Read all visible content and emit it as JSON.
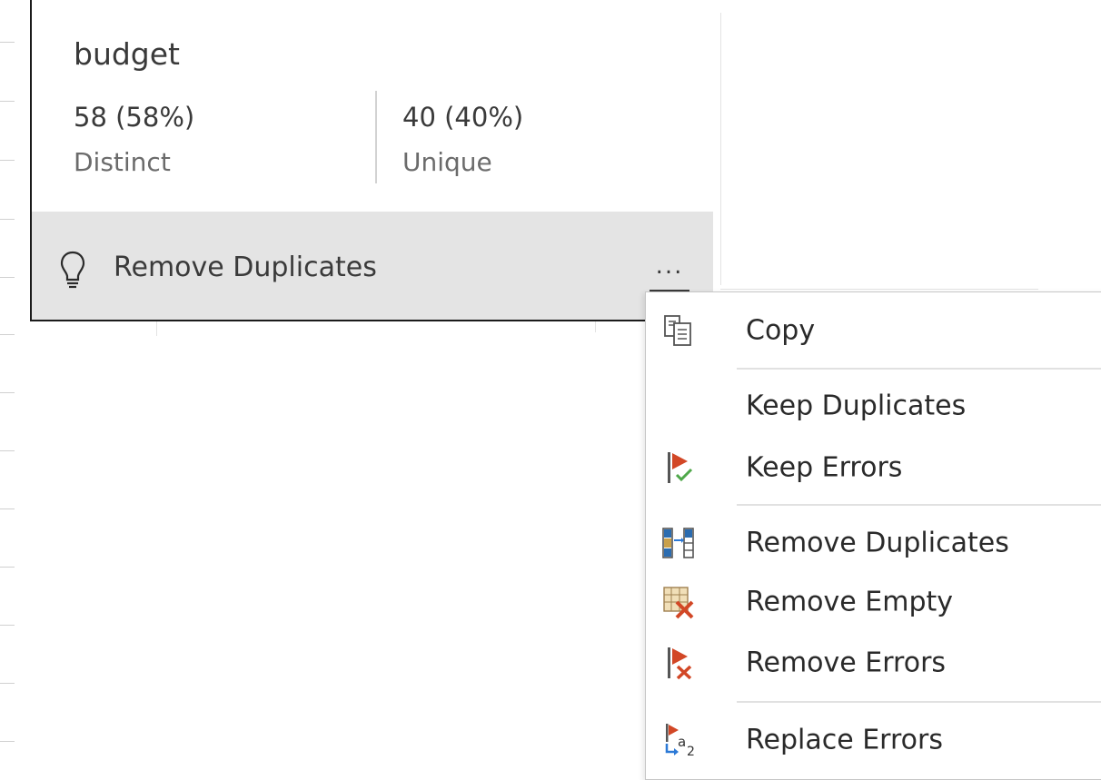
{
  "column_profile": {
    "column_name": "budget",
    "distinct": {
      "value": "58 (58%)",
      "label": "Distinct"
    },
    "unique": {
      "value": "40 (40%)",
      "label": "Unique"
    },
    "suggestion": {
      "label": "Remove Duplicates",
      "icon": "lightbulb-icon"
    },
    "more_button": {
      "label": "..."
    }
  },
  "context_menu": {
    "items": [
      {
        "label": "Copy",
        "icon": "copy-icon"
      },
      {
        "label": "Keep Duplicates",
        "icon": ""
      },
      {
        "label": "Keep Errors",
        "icon": "keep-errors-icon"
      },
      {
        "label": "Remove Duplicates",
        "icon": "remove-duplicates-icon"
      },
      {
        "label": "Remove Empty",
        "icon": "remove-empty-icon"
      },
      {
        "label": "Remove Errors",
        "icon": "remove-errors-icon"
      },
      {
        "label": "Replace Errors",
        "icon": "replace-errors-icon"
      }
    ]
  },
  "colors": {
    "error_red": "#d24726",
    "success_green": "#4fa84a",
    "accent_blue": "#2b79d6",
    "icon_gold": "#c9a04a",
    "footer_gray": "#e4e4e4"
  }
}
